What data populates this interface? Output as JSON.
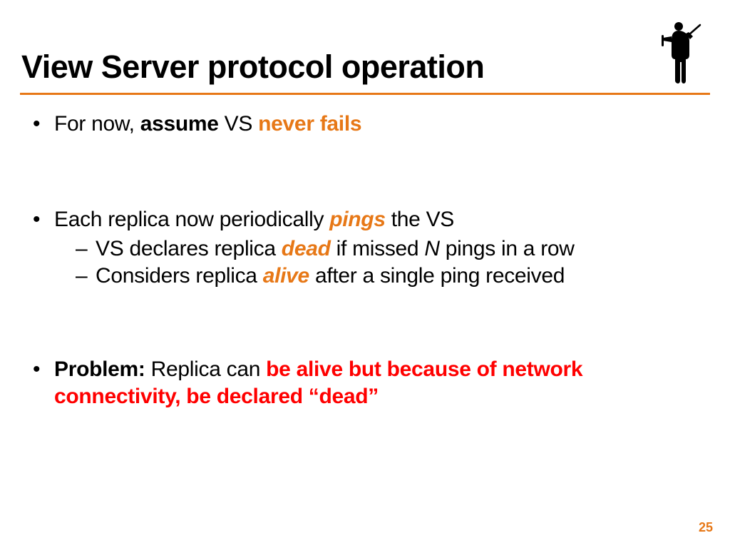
{
  "title": "View Server protocol operation",
  "bullets": {
    "b1": {
      "t1": "For now, ",
      "t2": "assume",
      "t3": " VS ",
      "t4": "never fails"
    },
    "b2": {
      "t1": "Each replica now periodically ",
      "t2": "pings",
      "t3": " the VS",
      "s1": {
        "a": "VS declares replica ",
        "b": "dead",
        "c": " if missed ",
        "d": "N",
        "e": " pings in a row"
      },
      "s2": {
        "a": "Considers replica ",
        "b": "alive",
        "c": " after a single ping received"
      }
    },
    "b3": {
      "t1": "Problem:",
      "t2": " Replica can ",
      "t3": "be alive but because of network connectivity, be declared “dead”"
    }
  },
  "page_number": "25"
}
